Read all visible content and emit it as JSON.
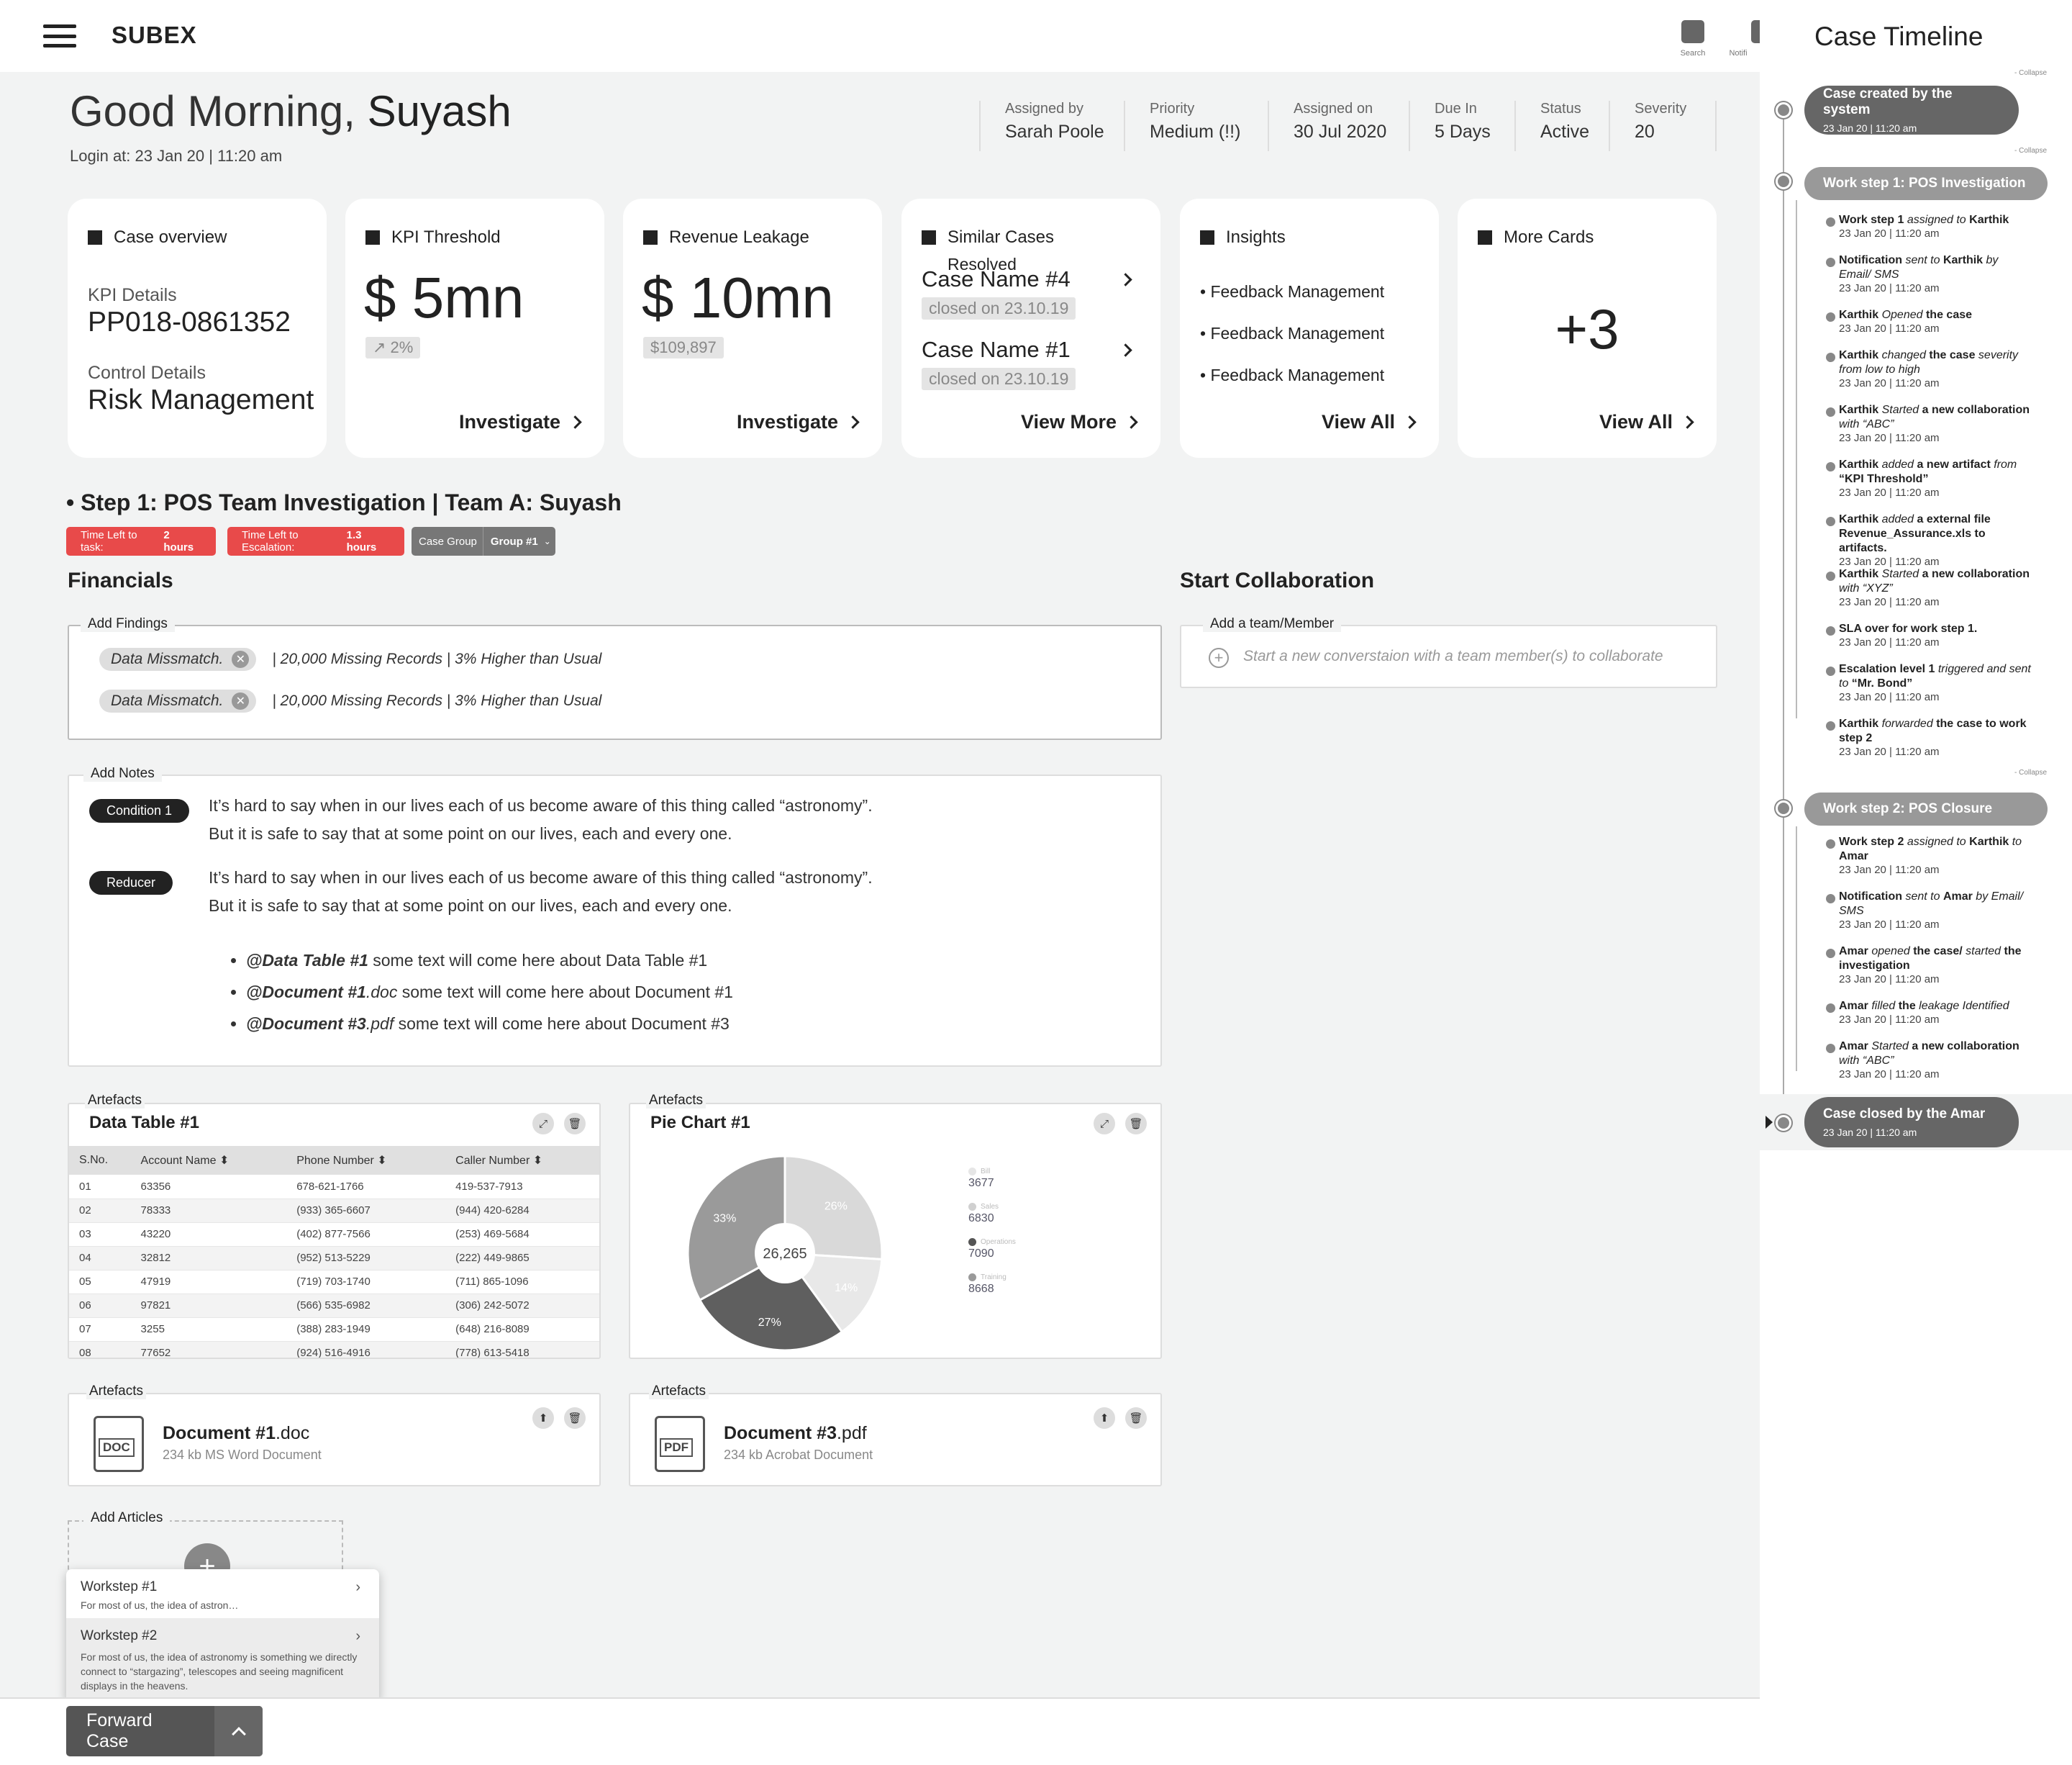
{
  "app": {
    "brand": "SUBEX",
    "search_label": "Search",
    "notif_label": "Notifi"
  },
  "greeting": {
    "prefix": "Good Morning,",
    "name": "Suyash",
    "login": "Login at:  23 Jan 20 | 11:20 am"
  },
  "case_meta": [
    {
      "label": "Assigned by",
      "value": "Sarah Poole"
    },
    {
      "label": "Priority",
      "value": "Medium (!!)"
    },
    {
      "label": "Assigned on",
      "value": "30 Jul 2020"
    },
    {
      "label": "Due In",
      "value": "5 Days"
    },
    {
      "label": "Status",
      "value": "Active"
    },
    {
      "label": "Severity",
      "value": "20"
    }
  ],
  "cards": {
    "overview": {
      "title": "Case overview",
      "kpi_label": "KPI Details",
      "kpi_value": "PP018-0861352",
      "control_label": "Control Details",
      "control_value": "Risk Management"
    },
    "kpi": {
      "title": "KPI Threshold",
      "value": "$ 5mn",
      "delta": "↗ 2%",
      "action": "Investigate"
    },
    "revenue": {
      "title": "Revenue Leakage",
      "value": "$ 10mn",
      "delta": "$109,897",
      "action": "Investigate"
    },
    "similar": {
      "title": "Similar Cases",
      "resolved": "Resolved",
      "case1": "Case Name #4",
      "case1_status": "closed on 23.10.19",
      "case2": "Case Name #1",
      "case2_status": "closed on 23.10.19",
      "action": "View More"
    },
    "insights": {
      "title": "Insights",
      "items": [
        "• Feedback Management",
        "• Feedback Management",
        "• Feedback Management"
      ],
      "action": "View All"
    },
    "more": {
      "title": "More Cards",
      "value": "+3",
      "action": "View All"
    }
  },
  "step": {
    "title": "• Step 1: POS Team Investigation |  Team A: Suyash",
    "time_task_label": "Time Left to task:",
    "time_task_value": "2 hours",
    "time_esc_label": "Time Left to Escalation:",
    "time_esc_value": "1.3 hours",
    "group_label": "Case Group",
    "group_value": "Group #1"
  },
  "financials": {
    "title": "Financials",
    "findings_label": "Add Findings",
    "findings": [
      {
        "chip": "Data Missmatch.",
        "text": "|  20,000 Missing Records  |  3% Higher than Usual"
      },
      {
        "chip": "Data Missmatch.",
        "text": "|  20,000 Missing Records  |  3% Higher than Usual"
      }
    ]
  },
  "collab": {
    "title": "Start Collaboration",
    "label": "Add a team/Member",
    "placeholder": "Start a new converstaion with a  team member(s) to collaborate"
  },
  "notes": {
    "label": "Add Notes",
    "items": [
      {
        "tag": "Condition 1",
        "line1": "It’s hard to say when in our lives each of us become aware of this thing called “astronomy”.",
        "line2": "But it is safe to say that at some point on our lives, each and every one."
      },
      {
        "tag": "Reducer",
        "line1": "It’s hard to say when in our lives each of us become aware of this thing called “astronomy”.",
        "line2": "But it is safe to say that at some point on our lives, each and every one."
      }
    ],
    "bullets": [
      {
        "ref": "@Data Table #1",
        "ext": "",
        "text": " some text will come here about Data Table #1"
      },
      {
        "ref": "@Document #1",
        "ext": ".doc",
        "text": " some text will come here about Document #1"
      },
      {
        "ref": "@Document #3",
        "ext": ".pdf",
        "text": " some text will come here about Document #3"
      }
    ]
  },
  "artefacts": {
    "label": "Artefacts",
    "table": {
      "title": "Data Table #1",
      "columns": [
        "S.No.",
        "Account Name",
        "Phone Number",
        "Caller Number"
      ],
      "rows": [
        [
          "01",
          "63356",
          "678-621-1766",
          "419-537-7913"
        ],
        [
          "02",
          "78333",
          "(933) 365-6607",
          "(944) 420-6284"
        ],
        [
          "03",
          "43220",
          "(402) 877-7566",
          "(253) 469-5684"
        ],
        [
          "04",
          "32812",
          "(952) 513-5229",
          "(222) 449-9865"
        ],
        [
          "05",
          "47919",
          "(719) 703-1740",
          "(711) 865-1096"
        ],
        [
          "06",
          "97821",
          "(566) 535-6982",
          "(306) 242-5072"
        ],
        [
          "07",
          "3255",
          "(388) 283-1949",
          "(648) 216-8089"
        ],
        [
          "08",
          "77652",
          "(924) 516-4916",
          "(778) 613-5418"
        ]
      ]
    },
    "pie": {
      "title": "Pie Chart #1",
      "center": "26,265"
    },
    "doc1": {
      "name": "Document #1",
      "ext": ".doc",
      "meta": "234 kb MS Word Document",
      "badge": "DOC"
    },
    "doc3": {
      "name": "Document #3",
      "ext": ".pdf",
      "meta": "234 kb Acrobat Document",
      "badge": "PDF"
    }
  },
  "chart_data": {
    "type": "pie",
    "title": "Pie Chart #1",
    "center_label": "26,265",
    "slices": [
      {
        "label": "26%",
        "value": 26,
        "color": "#d9d9d9"
      },
      {
        "label": "14%",
        "value": 14,
        "color": "#e8e8e8"
      },
      {
        "label": "27%",
        "value": 27,
        "color": "#5f5f5f"
      },
      {
        "label": "33%",
        "value": 33,
        "color": "#9a9a9a"
      }
    ],
    "legend": [
      {
        "name": "Bill",
        "value": "3677",
        "color": "#e6e6e6"
      },
      {
        "name": "Sales",
        "value": "6830",
        "color": "#d0d0d0"
      },
      {
        "name": "Operations",
        "value": "7090",
        "color": "#555555"
      },
      {
        "name": "Training",
        "value": "8668",
        "color": "#9a9a9a"
      }
    ]
  },
  "articles": {
    "label": "Add Articles",
    "items": [
      {
        "title": "Workstep #1",
        "desc": "For most of us, the idea of astron…"
      },
      {
        "title": "Workstep #2",
        "desc": "For most of us, the idea of astronomy is something we directly connect to “stargazing”, telescopes and seeing magnificent displays in the heavens."
      }
    ]
  },
  "forward": {
    "label": "Forward Case"
  },
  "timeline": {
    "title": "Case Timeline",
    "collapse": "- Collapse",
    "created": {
      "title": "Case created by the system",
      "date": "23 Jan 20 | 11:20 am"
    },
    "ws1": {
      "title": "Work step 1: POS Investigation"
    },
    "ws1_events": [
      {
        "html": "<b>Work step 1</b> <i>assigned to</i> <b>Karthik</b>",
        "date": "23 Jan 20 | 11:20 am"
      },
      {
        "html": "<b>Notification</b> <i>sent to</i> <b>Karthik</b> <i>by Email/ SMS</i>",
        "date": "23 Jan 20 | 11:20 am"
      },
      {
        "html": "<b>Karthik</b> <i>Opened</i> <b>the case</b>",
        "date": "23 Jan 20 | 11:20 am"
      },
      {
        "html": "<b>Karthik</b> <i>changed</i> <b>the case</b> <i>severity from low to high</i>",
        "date": "23 Jan 20 | 11:20 am"
      },
      {
        "html": "<b>Karthik</b> <i>Started</i> <b>a new collaboration</b> <i>with “ABC”</i>",
        "date": "23 Jan 20 | 11:20 am"
      },
      {
        "html": "<b>Karthik</b> <i>added</i> <b>a new artifact</b> <i>from</i> <b>“KPI Threshold”</b>",
        "date": "23 Jan 20 | 11:20 am"
      },
      {
        "html": "<b>Karthik</b> <i>added</i> <b>a external file Revenue_Assurance.xls to artifacts.</b>",
        "date": "23 Jan 20 | 11:20 am"
      },
      {
        "html": "<b>Karthik</b> <i>Started</i> <b>a new collaboration</b> <i>with “XYZ”</i>",
        "date": "23 Jan 20 | 11:20 am"
      },
      {
        "html": "<b>SLA over for work step 1.</b>",
        "date": "23 Jan 20 | 11:20 am"
      },
      {
        "html": "<b>Escalation level 1</b> <i>triggered and sent to</i> <b>“Mr. Bond”</b>",
        "date": "23 Jan 20 | 11:20 am"
      },
      {
        "html": "<b>Karthik</b> <i>forwarded</i> <b>the case to work step 2</b>",
        "date": "23 Jan 20 | 11:20 am"
      }
    ],
    "ws2": {
      "title": "Work step 2: POS Closure"
    },
    "ws2_events": [
      {
        "html": "<b>Work step 2</b> <i>assigned to</i> <b>Karthik</b> <i>to</i> <b>Amar</b>",
        "date": "23 Jan 20 | 11:20 am"
      },
      {
        "html": "<b>Notification</b> <i>sent to</i> <b>Amar</b> <i>by Email/ SMS</i>",
        "date": "23 Jan 20 | 11:20 am"
      },
      {
        "html": "<b>Amar</b> <i>opened</i> <b>the case/</b> <i>started</i> <b>the investigation</b>",
        "date": "23 Jan 20 | 11:20 am"
      },
      {
        "html": "<b>Amar</b> <i>filled</i> <b>the</b> <i>leakage Identified</i>",
        "date": "23 Jan 20 | 11:20 am"
      },
      {
        "html": "<b>Amar</b> <i>Started</i> <b>a new collaboration</b> <i>with “ABC”</i>",
        "date": "23 Jan 20 | 11:20 am"
      }
    ],
    "closed": {
      "title": "Case closed by the Amar",
      "date": "23 Jan 20 | 11:20 am"
    }
  }
}
